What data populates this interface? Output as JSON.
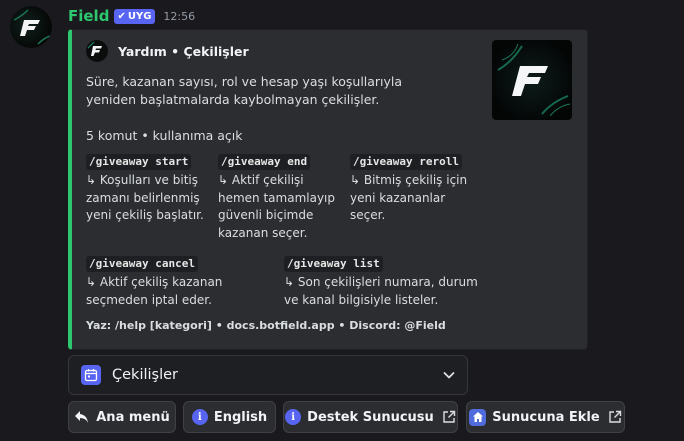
{
  "message": {
    "bot_name": "Field",
    "badge": "UYG",
    "timestamp": "12:56"
  },
  "embed": {
    "accent_color": "#2dc770",
    "author": "Yardım • Çekilişler",
    "description": "Süre, kazanan sayısı, rol ve hesap yaşı koşullarıyla yeniden başlatmalarda kaybolmayan çekilişler.",
    "summary": "5 komut • kullanıma açık",
    "fields": [
      {
        "name": "/giveaway start",
        "value": "↳ Koşulları ve bitiş\nzamanı belirlenmiş\nyeni çekiliş başlatır."
      },
      {
        "name": "/giveaway end",
        "value": "↳ Aktif çekilişi\nhemen tamamlayıp\ngüvenli biçimde\nkazanan seçer."
      },
      {
        "name": "/giveaway reroll",
        "value": "↳ Bitmiş çekiliş için\nyeni kazananlar\nseçer."
      },
      {
        "name": "/giveaway cancel",
        "value": "↳ Aktif çekiliş kazanan\nseçmeden iptal eder."
      },
      {
        "name": "/giveaway list",
        "value": "↳ Son çekilişleri numara, durum\nve kanal bilgisiyle listeler."
      }
    ],
    "footer": "Yaz: /help [kategori] • docs.botfield.app • Discord: @Field"
  },
  "select_menu": {
    "icon": "calendar-icon",
    "selected": "Çekilişler"
  },
  "buttons": [
    {
      "label": "Ana menü",
      "icon": "reply-arrow-icon"
    },
    {
      "label": "English",
      "icon": "info-icon"
    },
    {
      "label": "Destek Sunucusu",
      "icon": "info-icon",
      "external": true
    },
    {
      "label": "Sunucuna Ekle",
      "icon": "home-icon",
      "external": true
    }
  ]
}
